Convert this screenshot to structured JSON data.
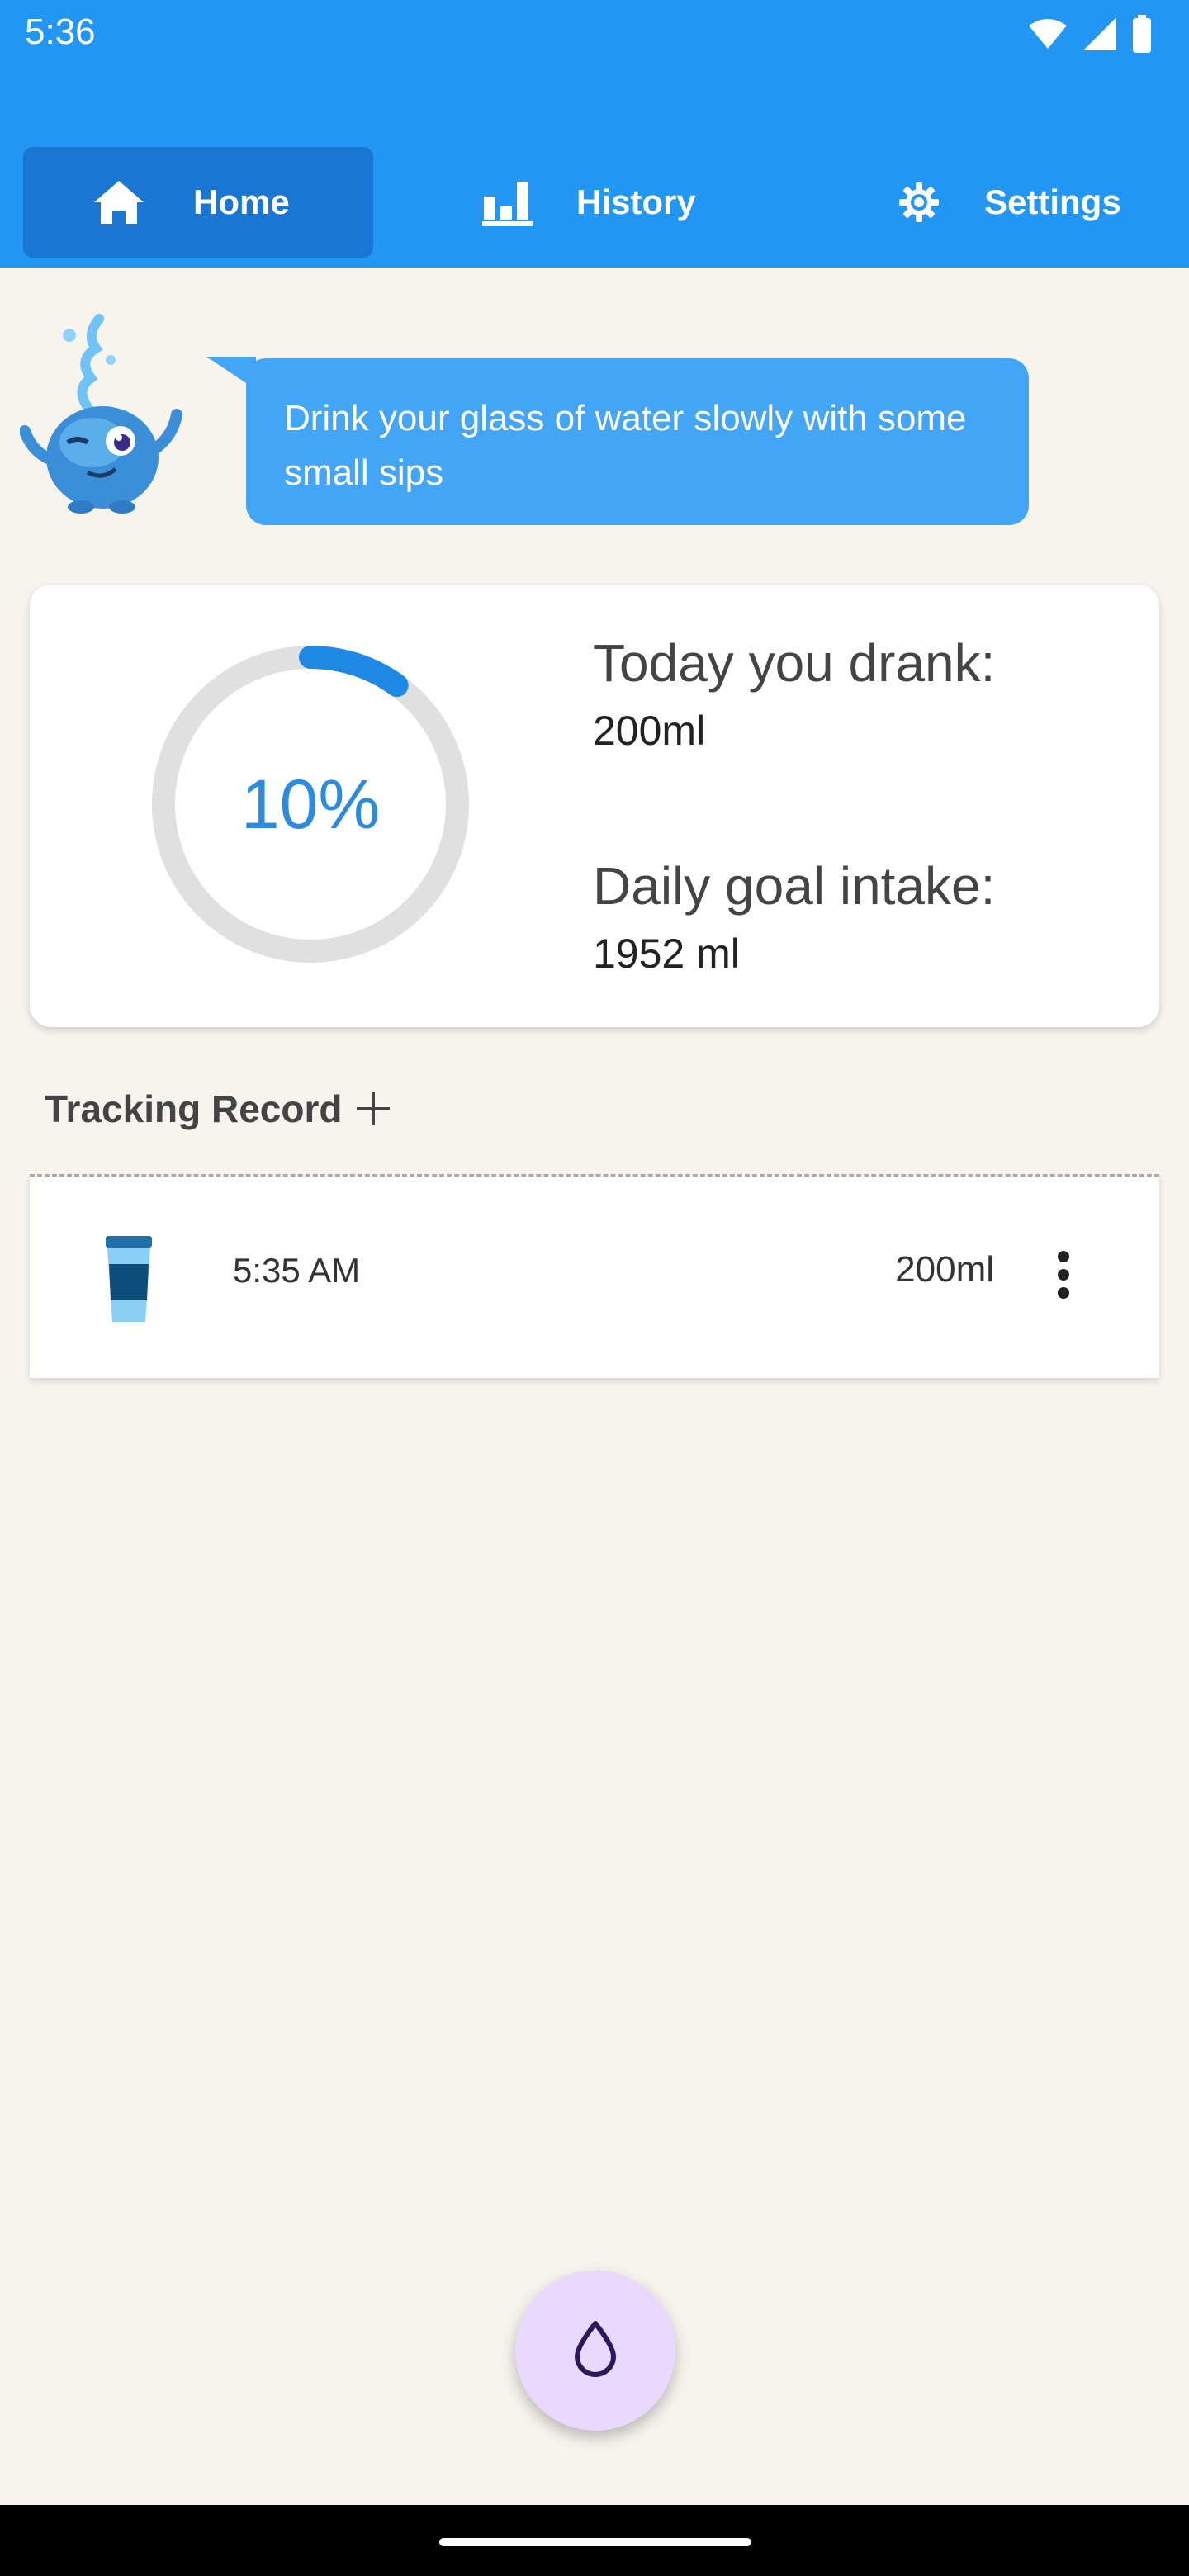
{
  "status": {
    "time": "5:36"
  },
  "tabs": [
    {
      "label": "Home",
      "icon": "home-icon",
      "active": true
    },
    {
      "label": "History",
      "icon": "bar-chart-icon",
      "active": false
    },
    {
      "label": "Settings",
      "icon": "gear-icon",
      "active": false
    }
  ],
  "tip": {
    "text": "Drink your glass of water slowly with some small sips"
  },
  "progress": {
    "percent_label": "10%",
    "percent": 10,
    "today_title": "Today you drank:",
    "today_value": "200ml",
    "goal_title": "Daily goal intake:",
    "goal_value": "1952 ml"
  },
  "tracking": {
    "title": "Tracking Record",
    "records": [
      {
        "time": "5:35 AM",
        "amount": "200ml",
        "icon": "cup-icon"
      }
    ]
  },
  "fab": {
    "icon": "water-drop-icon"
  },
  "colors": {
    "primary": "#2196f3",
    "primary_dark": "#1976d2",
    "bubble": "#42a5f5",
    "ring_track": "#e0e0e0",
    "ring_progress": "#1e88e5",
    "background": "#f7f4ee",
    "fab": "#ead9ff"
  }
}
